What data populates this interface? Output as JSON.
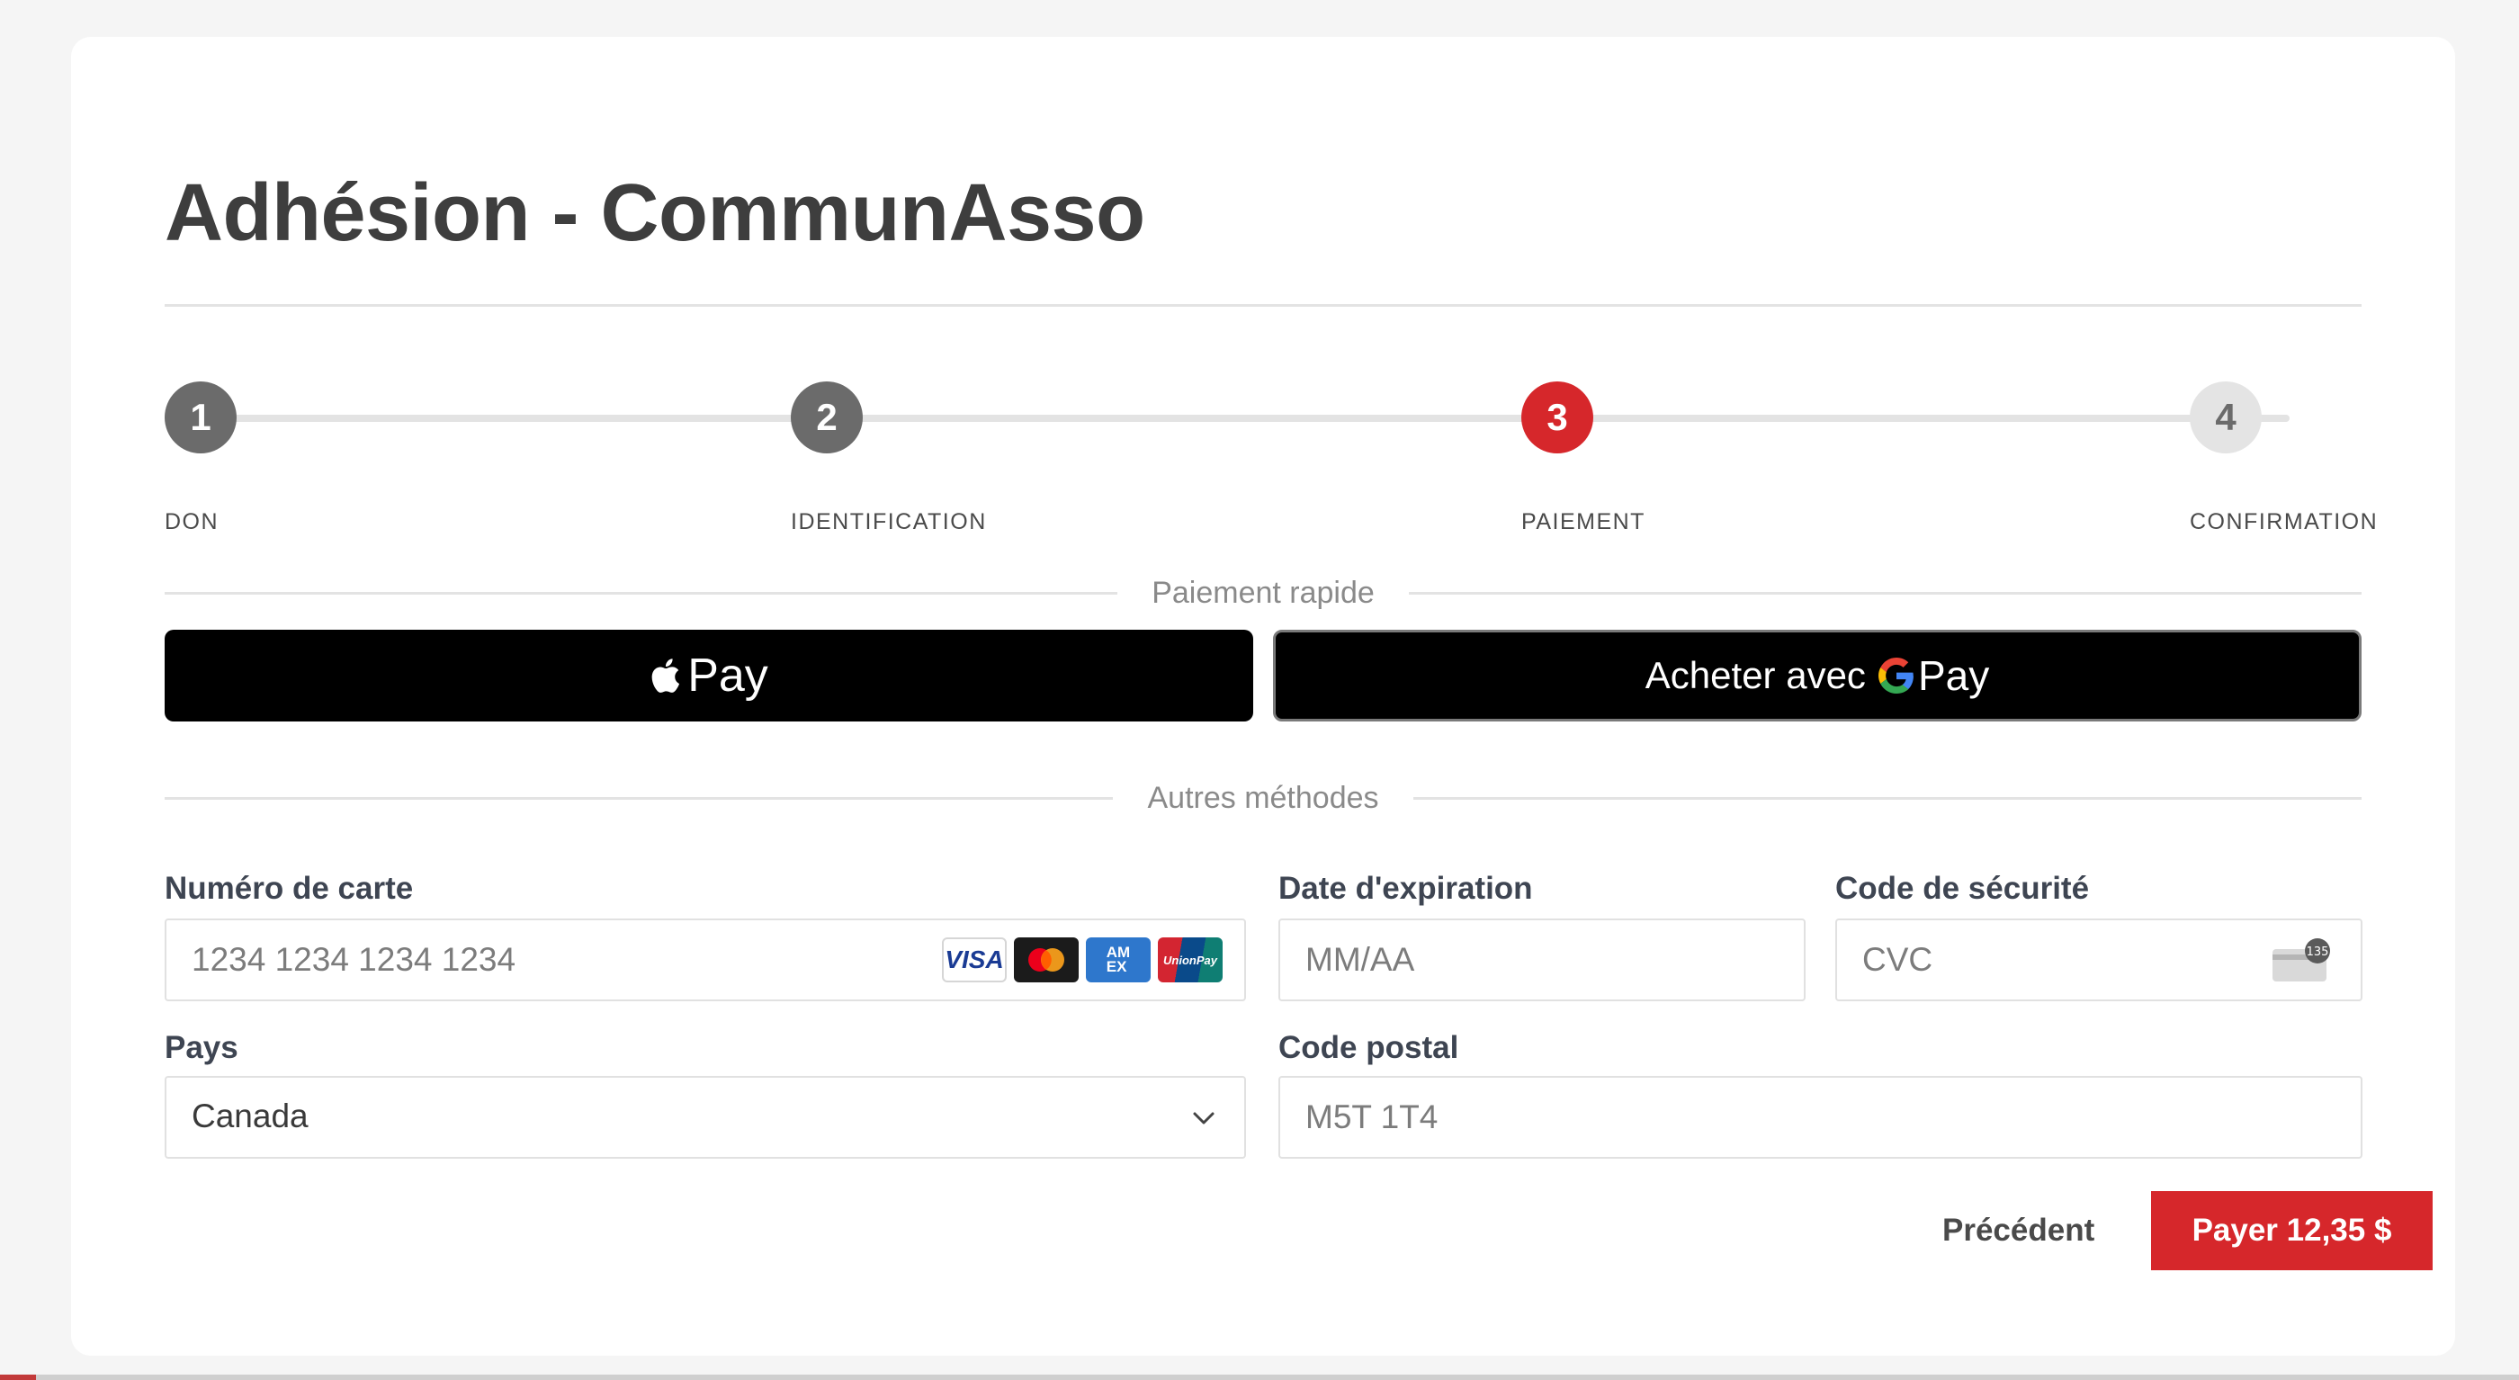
{
  "page": {
    "title": "Adhésion - CommunAsso"
  },
  "stepper": {
    "steps": [
      {
        "number": "1",
        "label": "DON",
        "state": "done"
      },
      {
        "number": "2",
        "label": "IDENTIFICATION",
        "state": "done"
      },
      {
        "number": "3",
        "label": "PAIEMENT",
        "state": "active"
      },
      {
        "number": "4",
        "label": "CONFIRMATION",
        "state": "todo"
      }
    ]
  },
  "quick_pay": {
    "heading": "Paiement rapide",
    "apple_pay_label": "Pay",
    "google_pay_prefix": "Acheter avec",
    "google_pay_label": "Pay"
  },
  "other_methods": {
    "heading": "Autres méthodes"
  },
  "form": {
    "card_number": {
      "label": "Numéro de carte",
      "placeholder": "1234 1234 1234 1234",
      "value": ""
    },
    "card_brands": [
      "visa",
      "mastercard",
      "amex",
      "unionpay"
    ],
    "expiry": {
      "label": "Date d'expiration",
      "placeholder": "MM/AA",
      "value": ""
    },
    "cvc": {
      "label": "Code de sécurité",
      "placeholder": "CVC",
      "value": "",
      "icon_badge": "135"
    },
    "country": {
      "label": "Pays",
      "value": "Canada"
    },
    "postal_code": {
      "label": "Code postal",
      "placeholder": "M5T 1T4",
      "value": ""
    }
  },
  "actions": {
    "previous_label": "Précédent",
    "pay_label": "Payer 12,35 $"
  },
  "colors": {
    "accent": "#d6272b",
    "step_done": "#6b6b6b",
    "step_todo": "#e4e4e4"
  }
}
